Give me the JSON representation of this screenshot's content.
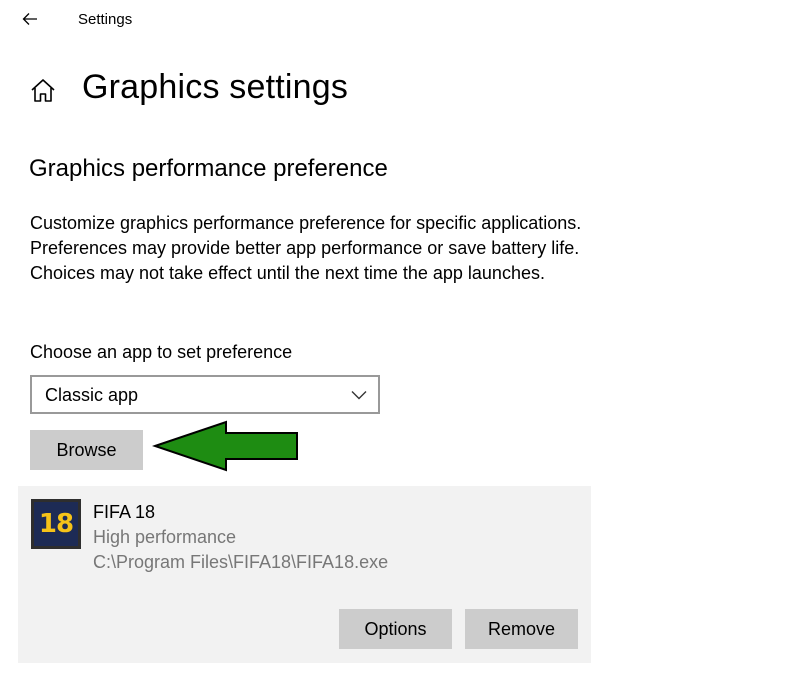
{
  "window": {
    "title": "Settings",
    "back_icon": "back-arrow-icon"
  },
  "header": {
    "home_icon": "home-icon",
    "title": "Graphics settings"
  },
  "section": {
    "title": "Graphics performance preference",
    "description": "Customize graphics performance preference for specific applications. Preferences may provide better app performance or save battery life. Choices may not take effect until the next time the app launches."
  },
  "app_picker": {
    "label": "Choose an app to set preference",
    "selected": "Classic app",
    "browse_label": "Browse"
  },
  "annotation": {
    "arrow_color": "#1e8c12",
    "arrow_outline": "#000000"
  },
  "apps": [
    {
      "icon_text": "18",
      "name": "FIFA 18",
      "preference": "High performance",
      "path": "C:\\Program Files\\FIFA18\\FIFA18.exe",
      "options_label": "Options",
      "remove_label": "Remove"
    }
  ]
}
